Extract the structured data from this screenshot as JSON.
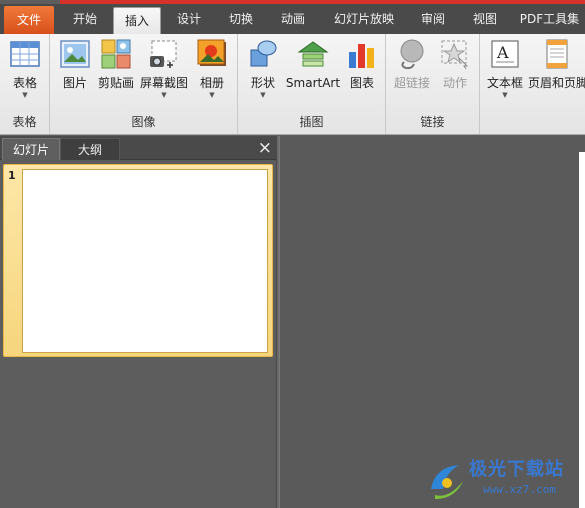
{
  "tabs": [
    {
      "label": "文件",
      "kind": "file"
    },
    {
      "label": "开始",
      "kind": "normal"
    },
    {
      "label": "插入",
      "kind": "active"
    },
    {
      "label": "设计",
      "kind": "normal"
    },
    {
      "label": "切换",
      "kind": "normal"
    },
    {
      "label": "动画",
      "kind": "normal"
    },
    {
      "label": "幻灯片放映",
      "kind": "normal"
    },
    {
      "label": "审阅",
      "kind": "normal"
    },
    {
      "label": "视图",
      "kind": "normal"
    },
    {
      "label": "PDF工具集",
      "kind": "normal"
    }
  ],
  "ribbon": {
    "groups": {
      "table": "表格",
      "image": "图像",
      "illustration": "插图",
      "link": "链接"
    },
    "buttons": {
      "table": "表格",
      "picture": "图片",
      "clipart": "剪贴画",
      "screenshot": "屏幕截图",
      "album": "相册",
      "shapes": "形状",
      "smartart": "SmartArt",
      "chart": "图表",
      "hyperlink": "超链接",
      "action": "动作",
      "textbox": "文本框",
      "header_footer": "页眉和页脚"
    }
  },
  "pane": {
    "tab_slides": "幻灯片",
    "tab_outline": "大纲",
    "close": "×",
    "slide_number": "1"
  },
  "watermark": {
    "name": "极光下载站",
    "url": "www.xz7.com"
  },
  "colors": {
    "accent": "#d4322a",
    "file_tab": "#e0602a",
    "selected_thumb": "#f6d57c",
    "background": "#5d5d5d"
  }
}
